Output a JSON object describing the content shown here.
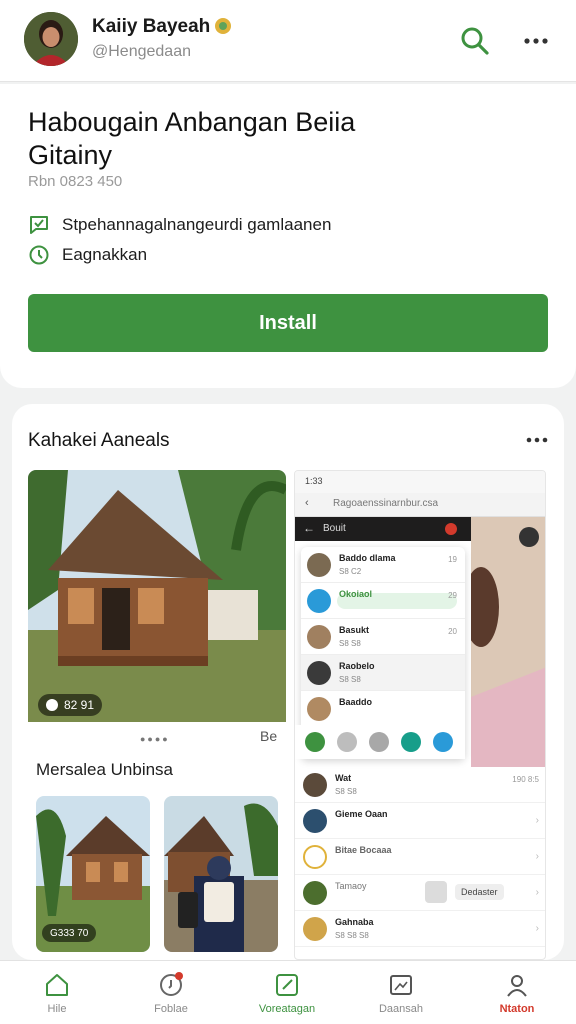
{
  "header": {
    "user_name": "Kaiiy Bayeah",
    "user_handle": "@Hengedaan"
  },
  "app": {
    "title": "Habougain Anbangan Beiia Gitainy",
    "meta": "Rbn 0823 450",
    "features": [
      {
        "label": "Stpehannagalnangeurdi gamlaanen",
        "icon": "chat-check-icon"
      },
      {
        "label": "Eagnakkan",
        "icon": "clock-icon"
      }
    ],
    "install_label": "Install",
    "accent": "#3e9240"
  },
  "gallery": {
    "title": "Kahakei Aaneals",
    "main_badge": "82 91",
    "pager_label": "Be",
    "subtitle": "Mersalea Unbinsa",
    "thumb_badge": "G333 70"
  },
  "phone": {
    "status_time": "1:33",
    "url_text": "Ragoaenssinarnbur.csa",
    "dark_bar_label": "Bouit",
    "chats": [
      {
        "name": "Baddo dlama",
        "sub": "S8 C2",
        "time": "19"
      },
      {
        "name": "Okoiaol",
        "sub": "",
        "time": "29"
      },
      {
        "name": "Basukt",
        "sub": "S8 S8",
        "time": "20"
      },
      {
        "name": "Raobelo",
        "sub": "S8 S8",
        "time": ""
      },
      {
        "name": "Baaddo",
        "sub": "",
        "time": ""
      }
    ],
    "list": [
      {
        "name": "Wat",
        "sub": "S8 S8",
        "time": "190 8:5"
      },
      {
        "name": "Gieme Oaan",
        "sub": "",
        "time": ""
      },
      {
        "name": "Bitae Bocaaa",
        "sub": "",
        "time": ""
      },
      {
        "name": "Tamaoy",
        "sub": "Dedaster",
        "time": ""
      },
      {
        "name": "Gahnaba",
        "sub": "S8 S8 S8",
        "time": ""
      }
    ]
  },
  "nav": [
    {
      "label": "Hile",
      "icon": "home-icon",
      "color": "#8a8a8a"
    },
    {
      "label": "Foblae",
      "icon": "bell-icon",
      "color": "#8a8a8a"
    },
    {
      "label": "Voreatagan",
      "icon": "edit-icon",
      "color": "#3e9240"
    },
    {
      "label": "Daansah",
      "icon": "image-icon",
      "color": "#8a8a8a"
    },
    {
      "label": "Ntaton",
      "icon": "profile-icon",
      "color": "#d33a2c"
    }
  ]
}
